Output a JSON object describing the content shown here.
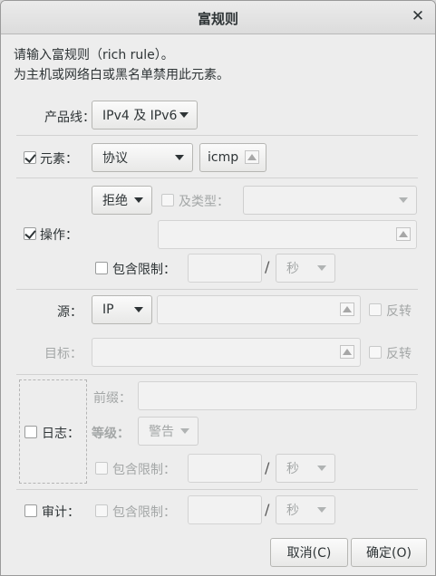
{
  "dialog": {
    "title": "富规则",
    "intro_line1": "请输入富规则（rich rule）。",
    "intro_line2": "为主机或网络白或黑名单禁用此元素。"
  },
  "family": {
    "label": "产品线：",
    "value": "IPv4 及 IPv6"
  },
  "element": {
    "label": "元素：",
    "checked": true,
    "type": "协议",
    "value": "icmp"
  },
  "action": {
    "label": "操作：",
    "checked": true,
    "choice": "拒绝",
    "with_type_label": "及类型：",
    "with_type_value": "",
    "entry_value": "",
    "limit_label": "包含限制：",
    "limit_value": "",
    "limit_unit": "秒"
  },
  "source": {
    "label": "源：",
    "type": "IP",
    "value": "",
    "invert_label": "反转"
  },
  "destination": {
    "label": "目标：",
    "value": "",
    "invert_label": "反转"
  },
  "log": {
    "label": "日志：",
    "checked": false,
    "prefix_label": "前缀：",
    "prefix_value": "",
    "level_label": "等级：",
    "level_value": "警告",
    "limit_label": "包含限制：",
    "limit_value": "",
    "limit_unit": "秒"
  },
  "audit": {
    "label": "审计：",
    "checked": false,
    "limit_label": "包含限制：",
    "limit_value": "",
    "limit_unit": "秒"
  },
  "buttons": {
    "cancel": "取消(C)",
    "ok": "确定(O)"
  },
  "slash": "/"
}
